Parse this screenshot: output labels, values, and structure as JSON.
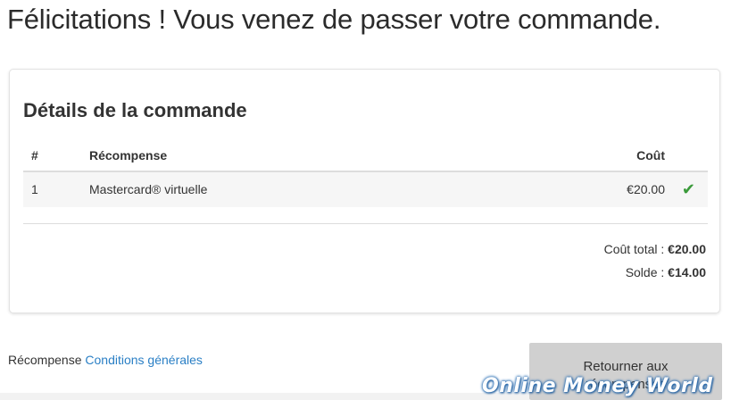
{
  "page": {
    "title": "Félicitations ! Vous venez de passer votre commande."
  },
  "order": {
    "section_title": "Détails de la commande",
    "columns": {
      "number": "#",
      "reward": "Récompense",
      "cost": "Coût"
    },
    "rows": [
      {
        "number": "1",
        "reward": "Mastercard® virtuelle",
        "cost": "€20.00",
        "status_icon": "checkmark-icon"
      }
    ],
    "total_label": "Coût total :",
    "total_value": "€20.00",
    "balance_label": "Solde :",
    "balance_value": "€14.00"
  },
  "footer": {
    "prefix": "Récompense",
    "terms_link": "Conditions générales",
    "return_button": "Retourner aux récompenses"
  },
  "watermark": {
    "text": "Online Money World"
  },
  "colors": {
    "link": "#2a7fc5",
    "check": "#3a9a3a",
    "button_bg": "#d0d0d0"
  }
}
